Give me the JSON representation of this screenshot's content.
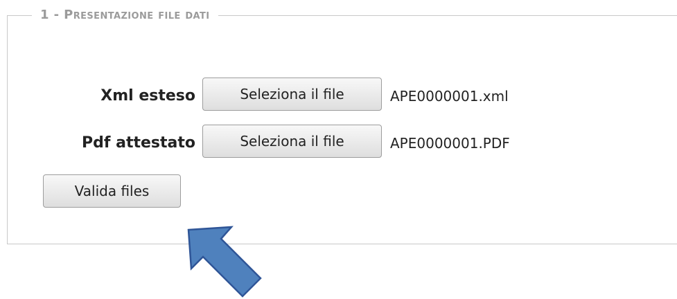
{
  "section": {
    "legend": "1 - Presentazione file dati"
  },
  "rows": [
    {
      "label": "Xml esteso",
      "button_label": "Seleziona il file",
      "file_name": "APE0000001.xml"
    },
    {
      "label": "Pdf attestato",
      "button_label": "Seleziona il file",
      "file_name": "APE0000001.PDF"
    }
  ],
  "actions": {
    "validate_label": "Valida files"
  },
  "colors": {
    "arrow_fill": "#4f81bd",
    "arrow_stroke": "#2f5597",
    "legend_text": "#9b9b9b"
  }
}
